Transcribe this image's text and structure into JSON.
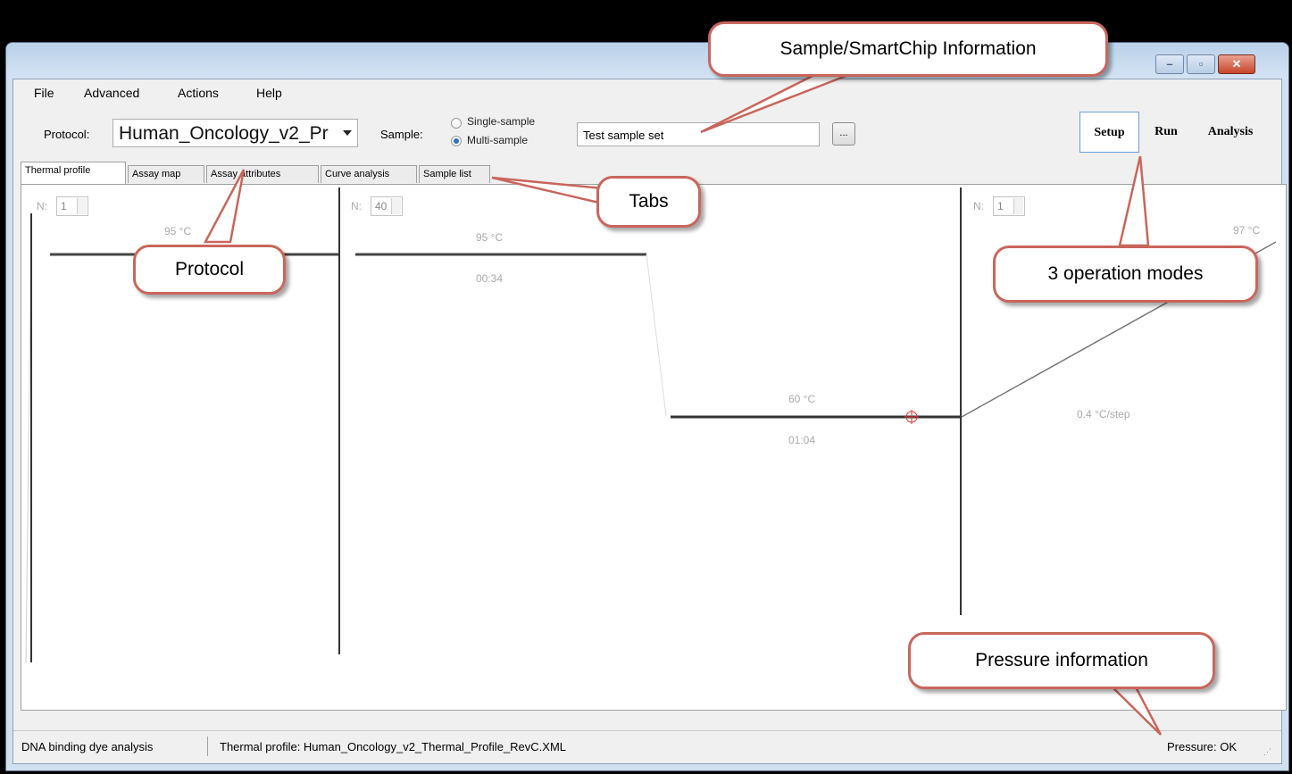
{
  "menu": [
    "File",
    "Advanced",
    "Actions",
    "Help"
  ],
  "toolbar": {
    "protocol_label": "Protocol:",
    "protocol_value": "Human_Oncology_v2_Pr",
    "sample_label": "Sample:",
    "single_sample": "Single-sample",
    "multi_sample": "Multi-sample",
    "sample_selected": "Multi-sample",
    "sample_set": "Test sample set",
    "browse": "..."
  },
  "modes": [
    "Setup",
    "Run",
    "Analysis"
  ],
  "active_mode": "Setup",
  "tabs": [
    "Thermal profile",
    "Assay map",
    "Assay attributes",
    "Curve analysis",
    "Sample list"
  ],
  "active_tab": "Thermal profile",
  "profile": {
    "stage1": {
      "n_label": "N:",
      "n": "1",
      "temp": "95 °C"
    },
    "stage2": {
      "n_label": "N:",
      "n": "40",
      "temp1": "95 °C",
      "time1": "00:34",
      "temp2": "60 °C",
      "time2": "01:04"
    },
    "stage3": {
      "n_label": "N:",
      "n": "1",
      "temp": "97 °C",
      "rate": "0.4 °C/step"
    }
  },
  "status": {
    "analysis": "DNA binding dye analysis",
    "profile": "Thermal profile: Human_Oncology_v2_Thermal_Profile_RevC.XML",
    "pressure": "Pressure: OK"
  },
  "callouts": {
    "sample_info": "Sample/SmartChip Information",
    "tabs": "Tabs",
    "protocol": "Protocol",
    "modes": "3 operation modes",
    "pressure": "Pressure information"
  },
  "colors": {
    "callout_border": "#c9665c",
    "mode_active_border": "#6aa0d8",
    "focus_marker": "#e03030"
  }
}
